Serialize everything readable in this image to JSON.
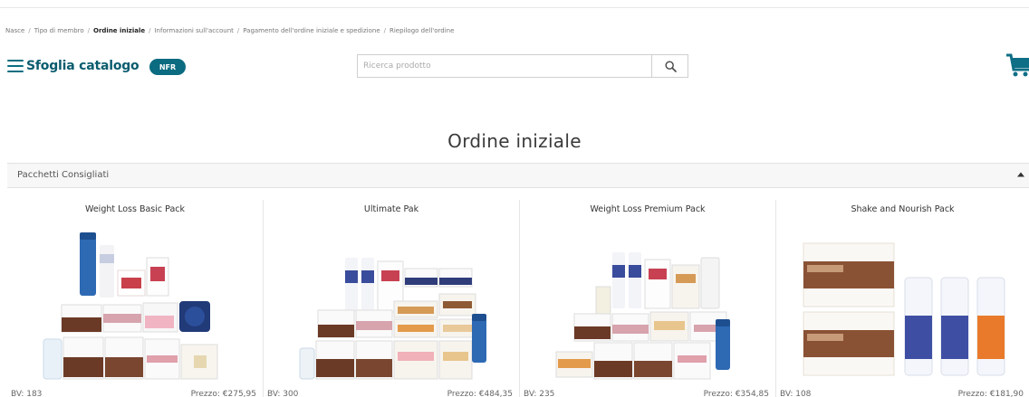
{
  "breadcrumb": {
    "items": [
      "Nasce",
      "Tipo di membro",
      "Ordine iniziale",
      "Informazioni sull'account",
      "Pagamento dell'ordine iniziale e spedizione",
      "Riepilogo dell'ordine"
    ],
    "current_index": 2
  },
  "header": {
    "catalog_label": "Sfoglia catalogo",
    "badge": "NFR",
    "search_placeholder": "Ricerca prodotto",
    "search_value": ""
  },
  "page": {
    "title": "Ordine iniziale"
  },
  "section": {
    "title": "Pacchetti Consigliati",
    "expanded": true,
    "products": [
      {
        "name": "Weight Loss Basic Pack",
        "bv": "BV: 183",
        "price": "Prezzo: €275,95",
        "image": "weight-loss-basic-pack-image"
      },
      {
        "name": "Ultimate Pak",
        "bv": "BV: 300",
        "price": "Prezzo: €484,35",
        "image": "ultimate-pak-image"
      },
      {
        "name": "Weight Loss Premium Pack",
        "bv": "BV: 235",
        "price": "Prezzo: €354,85",
        "image": "weight-loss-premium-pack-image"
      },
      {
        "name": "Shake and Nourish Pack",
        "bv": "BV: 108",
        "price": "Prezzo: €181,90",
        "image": "shake-and-nourish-pack-image"
      }
    ]
  },
  "icons": {
    "menu": "hamburger-menu-icon",
    "search": "search-icon",
    "cart": "shopping-cart-icon",
    "collapse": "caret-up-icon"
  },
  "colors": {
    "brand": "#0a5c6e",
    "badge_bg": "#0b6b80",
    "cart": "#0e6e86",
    "text": "#333333"
  }
}
